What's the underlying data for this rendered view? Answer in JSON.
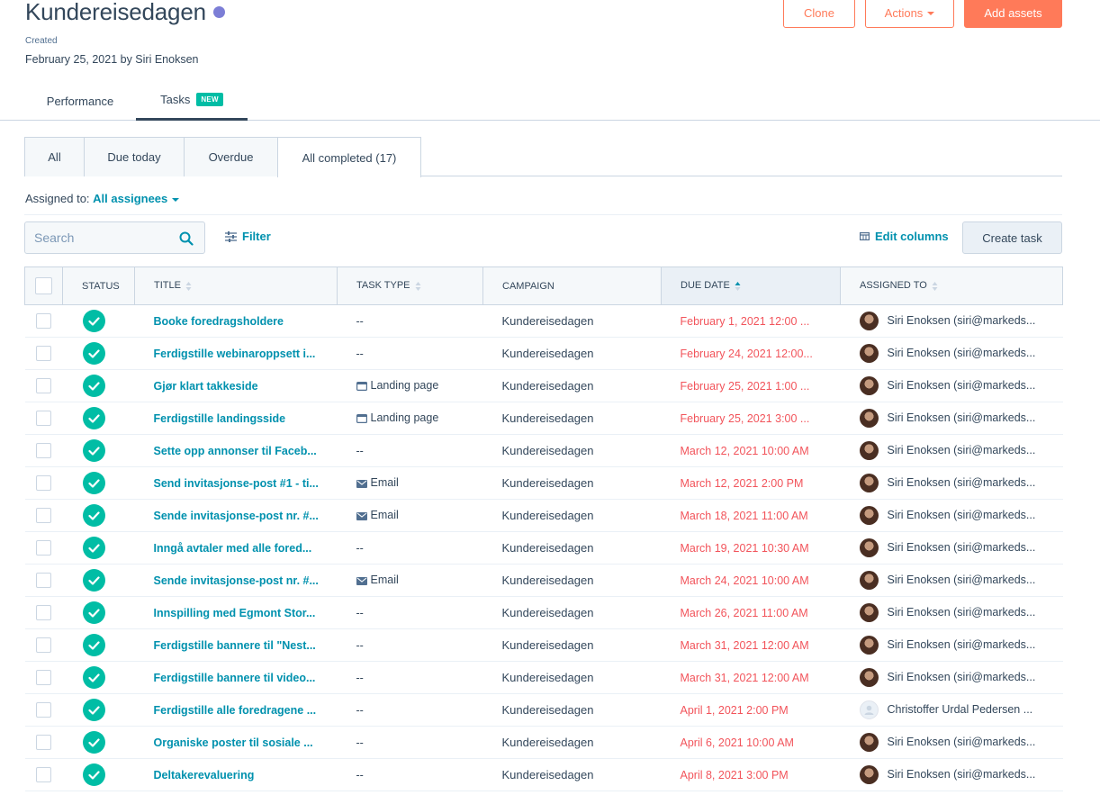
{
  "header": {
    "title": "Kundereisedagen",
    "status_dot_color": "#7c7ed6",
    "created_label": "Created",
    "created_value": "February 25, 2021 by Siri Enoksen",
    "clone_label": "Clone",
    "actions_label": "Actions",
    "add_assets_label": "Add assets"
  },
  "page_tabs": {
    "performance": "Performance",
    "tasks": "Tasks",
    "tasks_badge": "NEW"
  },
  "filter_tabs": {
    "all": "All",
    "due_today": "Due today",
    "overdue": "Overdue",
    "all_completed": "All completed (17)"
  },
  "assigned": {
    "label": "Assigned to:",
    "value": "All assignees"
  },
  "toolbar": {
    "search_placeholder": "Search",
    "filter_label": "Filter",
    "edit_columns_label": "Edit columns",
    "create_task_label": "Create task"
  },
  "table": {
    "columns": {
      "status": "STATUS",
      "title": "TITLE",
      "task_type": "TASK TYPE",
      "campaign": "CAMPAIGN",
      "due_date": "DUE DATE",
      "assigned_to": "ASSIGNED TO"
    },
    "rows": [
      {
        "title": "Booke foredragsholdere",
        "type": "--",
        "type_icon": "",
        "campaign": "Kundereisedagen",
        "due": "February 1, 2021 12:00 ...",
        "assignee": "Siri Enoksen (siri@markeds...",
        "avatar": "photo"
      },
      {
        "title": "Ferdigstille webinaroppsett i...",
        "type": "--",
        "type_icon": "",
        "campaign": "Kundereisedagen",
        "due": "February 24, 2021 12:00...",
        "assignee": "Siri Enoksen (siri@markeds...",
        "avatar": "photo"
      },
      {
        "title": "Gjør klart takkeside",
        "type": "Landing page",
        "type_icon": "landing-page-icon",
        "campaign": "Kundereisedagen",
        "due": "February 25, 2021 1:00 ...",
        "assignee": "Siri Enoksen (siri@markeds...",
        "avatar": "photo"
      },
      {
        "title": "Ferdigstille landingsside",
        "type": "Landing page",
        "type_icon": "landing-page-icon",
        "campaign": "Kundereisedagen",
        "due": "February 25, 2021 3:00 ...",
        "assignee": "Siri Enoksen (siri@markeds...",
        "avatar": "photo"
      },
      {
        "title": "Sette opp annonser til Faceb...",
        "type": "--",
        "type_icon": "",
        "campaign": "Kundereisedagen",
        "due": "March 12, 2021 10:00 AM",
        "assignee": "Siri Enoksen (siri@markeds...",
        "avatar": "photo"
      },
      {
        "title": "Send invitasjonse-post #1 - ti...",
        "type": "Email",
        "type_icon": "email-icon",
        "campaign": "Kundereisedagen",
        "due": "March 12, 2021 2:00 PM",
        "assignee": "Siri Enoksen (siri@markeds...",
        "avatar": "photo"
      },
      {
        "title": "Sende invitasjonse-post nr. #...",
        "type": "Email",
        "type_icon": "email-icon",
        "campaign": "Kundereisedagen",
        "due": "March 18, 2021 11:00 AM",
        "assignee": "Siri Enoksen (siri@markeds...",
        "avatar": "photo"
      },
      {
        "title": "Inngå avtaler med alle fored...",
        "type": "--",
        "type_icon": "",
        "campaign": "Kundereisedagen",
        "due": "March 19, 2021 10:30 AM",
        "assignee": "Siri Enoksen (siri@markeds...",
        "avatar": "photo"
      },
      {
        "title": "Sende invitasjonse-post nr. #...",
        "type": "Email",
        "type_icon": "email-icon",
        "campaign": "Kundereisedagen",
        "due": "March 24, 2021 10:00 AM",
        "assignee": "Siri Enoksen (siri@markeds...",
        "avatar": "photo"
      },
      {
        "title": "Innspilling med Egmont Stor...",
        "type": "--",
        "type_icon": "",
        "campaign": "Kundereisedagen",
        "due": "March 26, 2021 11:00 AM",
        "assignee": "Siri Enoksen (siri@markeds...",
        "avatar": "photo"
      },
      {
        "title": "Ferdigstille bannere til \"Nest...",
        "type": "--",
        "type_icon": "",
        "campaign": "Kundereisedagen",
        "due": "March 31, 2021 12:00 AM",
        "assignee": "Siri Enoksen (siri@markeds...",
        "avatar": "photo"
      },
      {
        "title": "Ferdigstille bannere til video...",
        "type": "--",
        "type_icon": "",
        "campaign": "Kundereisedagen",
        "due": "March 31, 2021 12:00 AM",
        "assignee": "Siri Enoksen (siri@markeds...",
        "avatar": "photo"
      },
      {
        "title": "Ferdigstille alle foredragene ...",
        "type": "--",
        "type_icon": "",
        "campaign": "Kundereisedagen",
        "due": "April 1, 2021 2:00 PM",
        "assignee": "Christoffer Urdal Pedersen ...",
        "avatar": "blank"
      },
      {
        "title": "Organiske poster til sosiale ...",
        "type": "--",
        "type_icon": "",
        "campaign": "Kundereisedagen",
        "due": "April 6, 2021 10:00 AM",
        "assignee": "Siri Enoksen (siri@markeds...",
        "avatar": "photo"
      },
      {
        "title": "Deltakerevaluering",
        "type": "--",
        "type_icon": "",
        "campaign": "Kundereisedagen",
        "due": "April 8, 2021 3:00 PM",
        "assignee": "Siri Enoksen (siri@markeds...",
        "avatar": "photo"
      }
    ]
  },
  "colors": {
    "accent_orange": "#ff7a59",
    "link_teal": "#0091ae",
    "success_green": "#00bda5",
    "overdue_red": "#f2545b"
  }
}
